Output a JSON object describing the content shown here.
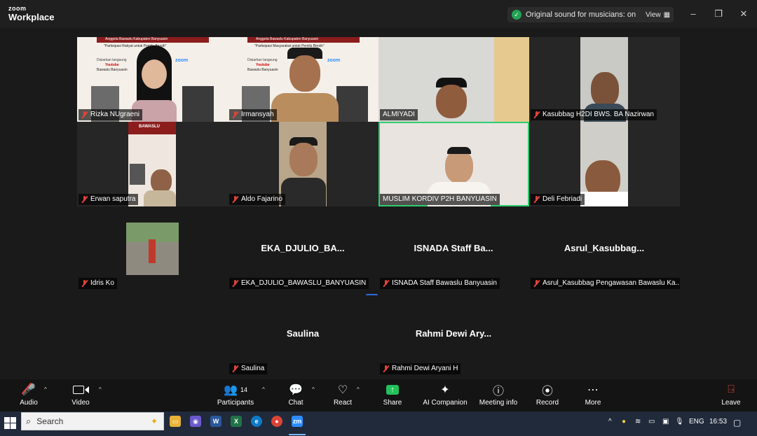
{
  "app": {
    "brand_top": "zoom",
    "brand_bottom": "Workplace"
  },
  "titlebar": {
    "sound_status": "Original sound for musicians: on",
    "view_label": "View",
    "view_icon": "grid-icon"
  },
  "participants_video": [
    {
      "name": "Rizka NUgraeni"
    },
    {
      "name": "Irmansyah"
    },
    {
      "name": "ALMIYADI"
    },
    {
      "name": "Kasubbag H2DI BWS. BA Nazirwan"
    },
    {
      "name": "Erwan saputra"
    },
    {
      "name": "Aldo Fajarino"
    },
    {
      "name": "MUSLIM KORDIV P2H BANYUASIN"
    },
    {
      "name": "Deli Febriadi"
    }
  ],
  "banner_texts": {
    "line1": "Anggota Bawaslu Kabupaten Banyuasin",
    "line2_a": "\"Partisipasi Rakyat untuk Pemilu Bersih\"",
    "line2_b": "\"Partisipasi Masyarakat untuk Pemilu Bersih\"",
    "live": "Disiarkan langsung",
    "youtube": "Youtube",
    "channel": "Bawaslu Banyuasin",
    "zoom": "zoom",
    "bawaslu": "BAWASLU"
  },
  "participants_novideo": [
    {
      "display": "",
      "name": "Idris Ko"
    },
    {
      "display": "EKA_DJULIO_BA...",
      "name": "EKA_DJULIO_BAWASLU_BANYUASIN"
    },
    {
      "display": "ISNADA Staff Ba...",
      "name": "ISNADA Staff Bawaslu Banyuasin"
    },
    {
      "display": "Asrul_Kasubbag...",
      "name": "Asrul_Kasubbag Pengawasan Bawaslu Ka..."
    },
    {
      "display": "Saulina",
      "name": "Saulina"
    },
    {
      "display": "Rahmi Dewi Ary...",
      "name": "Rahmi Dewi Aryani H"
    }
  ],
  "more_label": "...",
  "toolbar": {
    "audio": "Audio",
    "video": "Video",
    "participants": "Participants",
    "participants_count": "14",
    "chat": "Chat",
    "react": "React",
    "share": "Share",
    "ai": "AI Companion",
    "meeting_info": "Meeting info",
    "record": "Record",
    "more": "More",
    "leave": "Leave"
  },
  "taskbar": {
    "search": "Search",
    "lang": "ENG",
    "time": "16:53",
    "apps": [
      "file-explorer-icon",
      "copilot-icon",
      "word-icon",
      "excel-icon",
      "edge-icon",
      "chrome-icon",
      "zoom-icon"
    ]
  }
}
